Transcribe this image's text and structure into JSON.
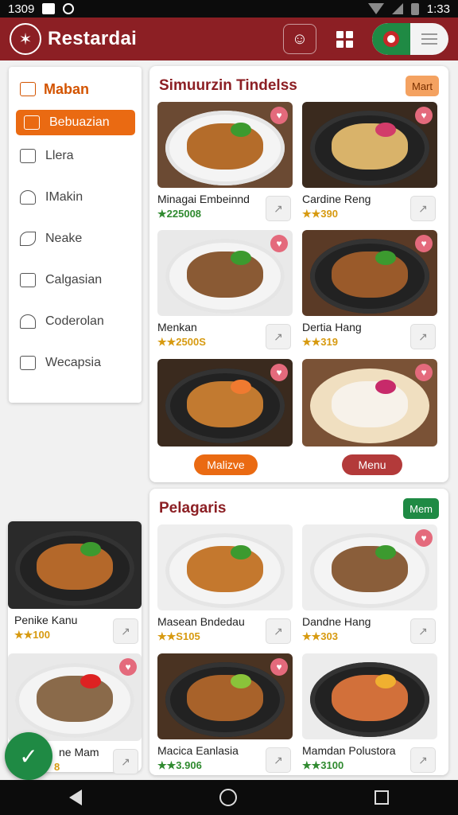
{
  "status": {
    "time_left": "1309",
    "time_right": "1:33"
  },
  "app": {
    "title": "Restardai"
  },
  "sidebar": {
    "header": "Maban",
    "items": [
      {
        "label": "Bebuazian",
        "icon": "hand-icon"
      },
      {
        "label": "Llera",
        "icon": "message-icon"
      },
      {
        "label": "IMakin",
        "icon": "person-icon"
      },
      {
        "label": "Neake",
        "icon": "leaf-icon"
      },
      {
        "label": "Calgasian",
        "icon": "square-icon"
      },
      {
        "label": "Coderolan",
        "icon": "user-icon"
      },
      {
        "label": "Wecapsia",
        "icon": "calendar-icon"
      }
    ]
  },
  "section1": {
    "title": "Simuurzin Tindelss",
    "tag": "Mart",
    "dishes": [
      {
        "name": "Minagai Embeinnd",
        "price": "★225008"
      },
      {
        "name": "Cardine Reng",
        "price": "★★390"
      },
      {
        "name": "Menkan",
        "price": "★★2500S"
      },
      {
        "name": "Dertia Hang",
        "price": "★★319"
      }
    ],
    "btn_left": "Malizve",
    "btn_right": "Menu"
  },
  "left_dishes": [
    {
      "name": "Penike Kanu",
      "price": "★★100"
    },
    {
      "name": "ne Mam",
      "price": "8"
    }
  ],
  "section2": {
    "title": "Pelagaris",
    "tag": "Mem",
    "dishes": [
      {
        "name": "Masean Bndedau",
        "price": "★★S105"
      },
      {
        "name": "Dandne Hang",
        "price": "★★303"
      },
      {
        "name": "Macica Eanlasia",
        "price": "★★3.906"
      },
      {
        "name": "Mamdan Polustora",
        "price": "★★3100"
      }
    ]
  },
  "colors": {
    "brand": "#8c1f24",
    "accent": "#ea6a12",
    "green": "#1f8a44"
  }
}
